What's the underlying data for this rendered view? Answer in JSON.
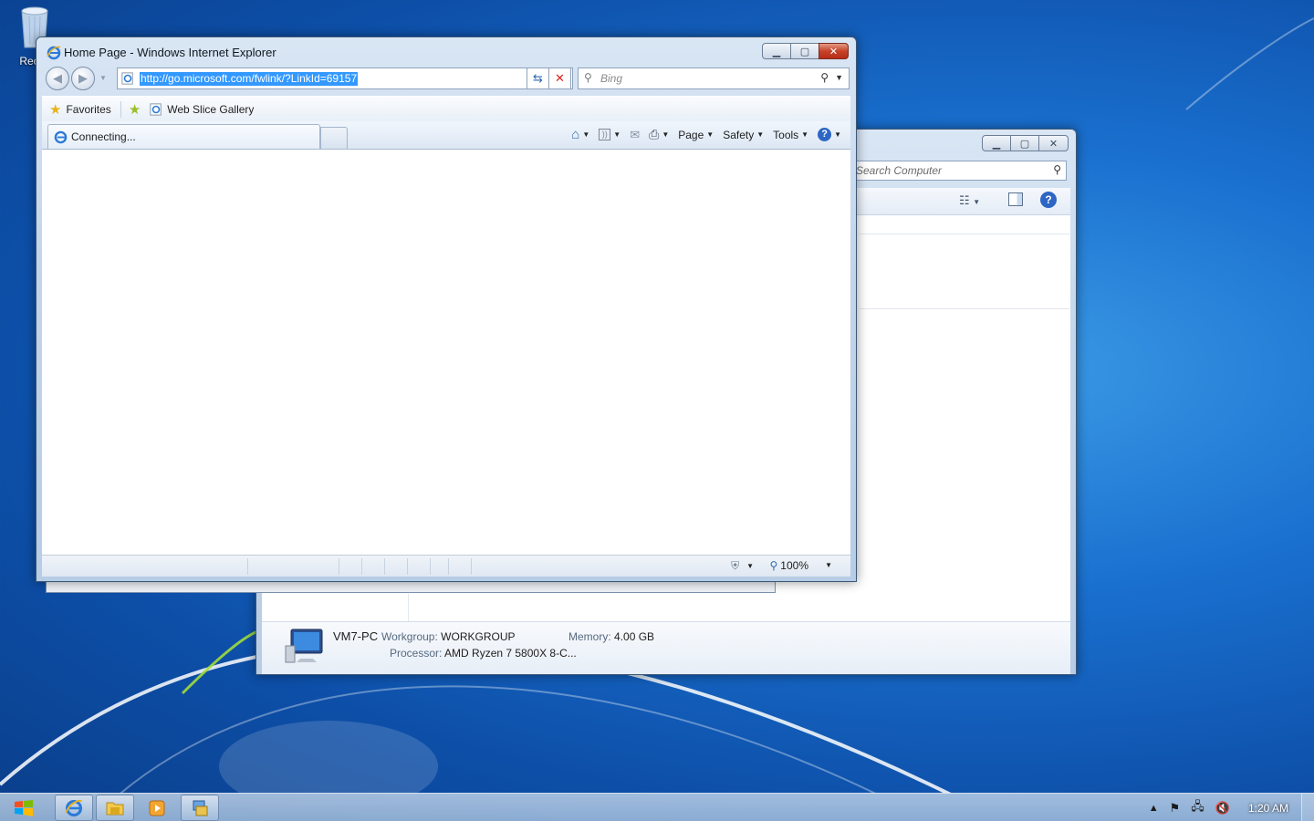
{
  "desktop": {
    "recycle_bin_label": "Recyc"
  },
  "ie_window": {
    "title": "Home Page - Windows Internet Explorer",
    "address_url": "http://go.microsoft.com/fwlink/?LinkId=69157",
    "search_placeholder": "Bing",
    "favorites_label": "Favorites",
    "web_slice_gallery_label": "Web Slice Gallery",
    "tab_label": "Connecting...",
    "cmd_page": "Page",
    "cmd_safety": "Safety",
    "cmd_tools": "Tools",
    "zoom_level": "100%"
  },
  "computer_window": {
    "search_placeholder": "Search Computer",
    "computer_name": "VM7-PC",
    "workgroup_label": "Workgroup:",
    "workgroup_value": "WORKGROUP",
    "memory_label": "Memory:",
    "memory_value": "4.00 GB",
    "processor_label": "Processor:",
    "processor_value": "AMD Ryzen 7 5800X 8-C..."
  },
  "taskbar": {
    "clock": "1:20 AM",
    "pinned": [
      "internet-explorer",
      "windows-explorer",
      "media-player",
      "network-app"
    ]
  },
  "colors": {
    "selection": "#3399ff",
    "close_button": "#c6432a",
    "desktop_blue": "#1a70cf"
  }
}
